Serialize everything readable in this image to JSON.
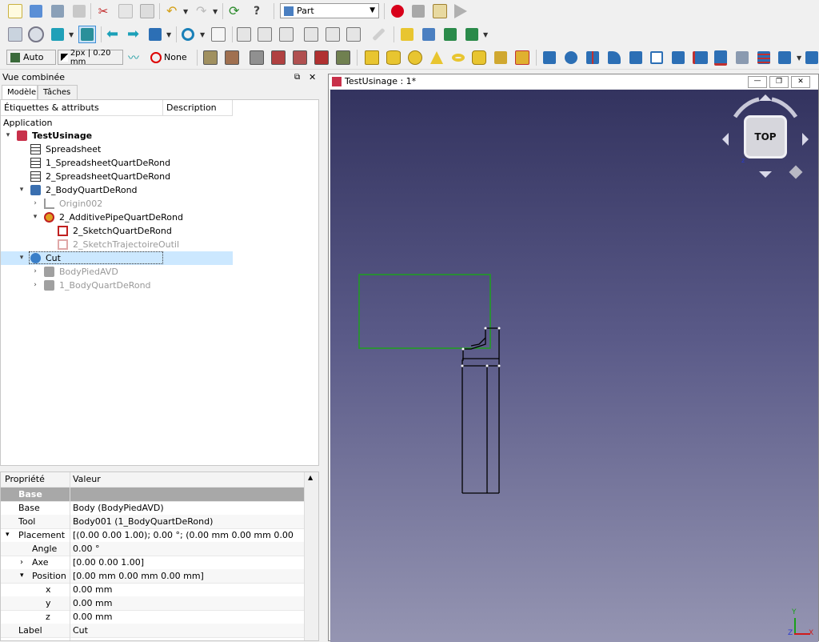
{
  "toolbar": {
    "workbench": "Part",
    "draw_style": "Auto",
    "line_width": "2px | 0.20 mm",
    "selection_filter": "None"
  },
  "panel": {
    "title": "Vue combinée",
    "tabs": [
      "Modèle",
      "Tâches"
    ],
    "tree_headers": [
      "Étiquettes & attributs",
      "Description"
    ],
    "tree": {
      "application": "Application",
      "document": "TestUsinage",
      "items": [
        "Spreadsheet",
        "1_SpreadsheetQuartDeRond",
        "2_SpreadsheetQuartDeRond",
        "2_BodyQuartDeRond",
        "Origin002",
        "2_AdditivePipeQuartDeRond",
        "2_SketchQuartDeRond",
        "2_SketchTrajectoireOutil",
        "Cut",
        "BodyPiedAVD",
        "1_BodyQuartDeRond"
      ]
    }
  },
  "properties": {
    "headers": [
      "Propriété",
      "Valeur"
    ],
    "group": "Base",
    "rows": [
      {
        "key": "Base",
        "value": "Body (BodyPiedAVD)"
      },
      {
        "key": "Tool",
        "value": "Body001 (1_BodyQuartDeRond)"
      },
      {
        "key": "Placement",
        "value": "[(0.00 0.00 1.00); 0.00 °; (0.00 mm  0.00 mm  0.00 mm)]"
      },
      {
        "key": "Angle",
        "value": "0.00 °"
      },
      {
        "key": "Axe",
        "value": "[0.00 0.00 1.00]"
      },
      {
        "key": "Position",
        "value": "[0.00 mm  0.00 mm  0.00 mm]"
      },
      {
        "key": "x",
        "value": "0.00 mm"
      },
      {
        "key": "y",
        "value": "0.00 mm"
      },
      {
        "key": "z",
        "value": "0.00 mm"
      },
      {
        "key": "Label",
        "value": "Cut"
      }
    ]
  },
  "view3d": {
    "title": "TestUsinage : 1*",
    "navcube_face": "TOP",
    "axes": [
      "Y",
      "X",
      "Z"
    ]
  },
  "colors": {
    "selection": "#cce8ff",
    "sketch_outline": "#1ea01e",
    "view_top": "#33335f",
    "view_bottom": "#9595b2"
  }
}
